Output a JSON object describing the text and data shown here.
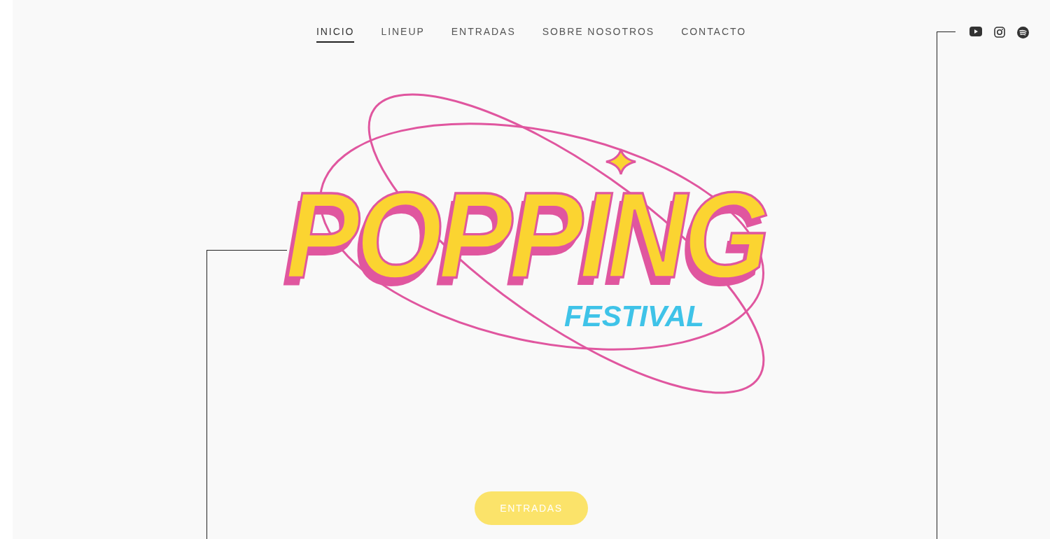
{
  "nav": [
    {
      "label": "INICIO",
      "selected": true
    },
    {
      "label": "LINEUP",
      "selected": false
    },
    {
      "label": "ENTRADAS",
      "selected": false
    },
    {
      "label": "SOBRE NOSOTROS",
      "selected": false
    },
    {
      "label": "CONTACTO",
      "selected": false
    }
  ],
  "logo": {
    "title": "POPPING",
    "subtitle": "FESTIVAL"
  },
  "cta": "ENTRADAS"
}
